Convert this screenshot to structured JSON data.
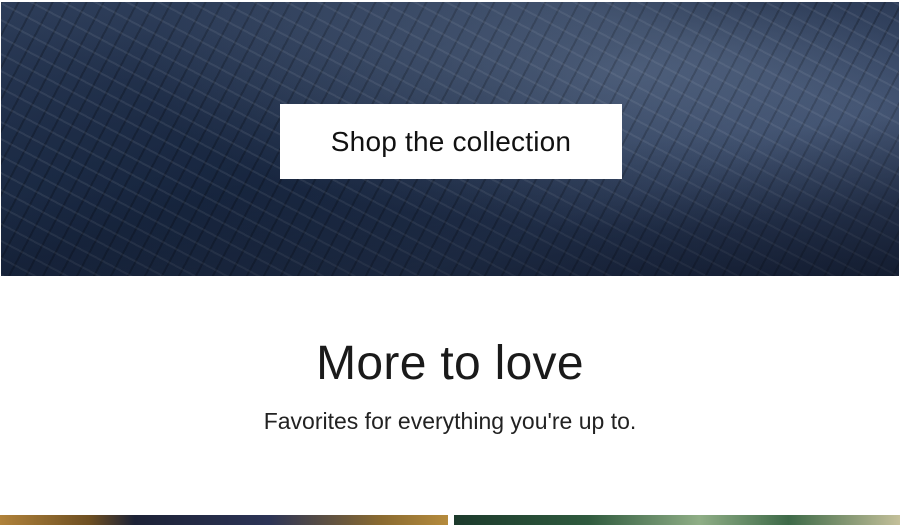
{
  "hero": {
    "cta_label": "Shop the collection"
  },
  "section": {
    "title": "More to love",
    "subtitle": "Favorites for everything you're up to."
  },
  "colors": {
    "hero_fabric": "#1f2d48",
    "button_bg": "#ffffff",
    "text": "#1a1a1a"
  }
}
